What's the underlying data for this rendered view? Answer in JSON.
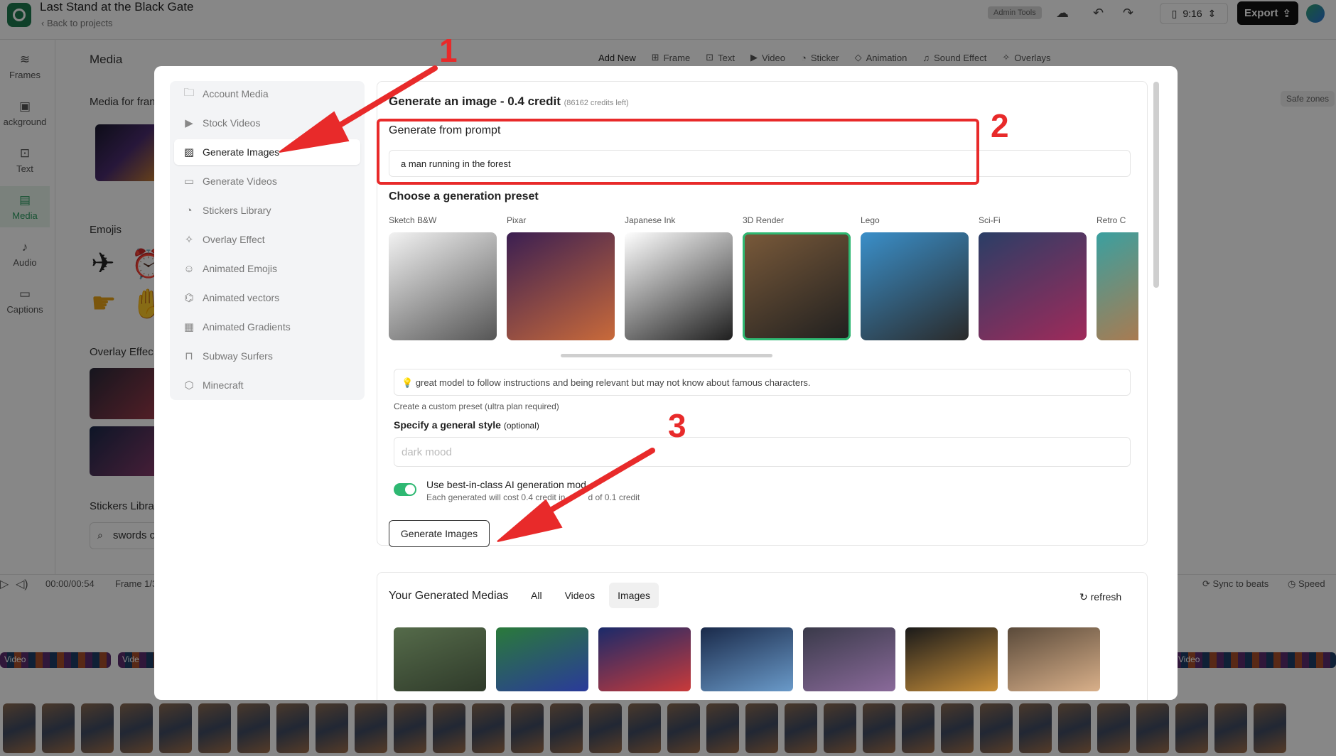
{
  "project": {
    "title": "Last Stand at the Black Gate",
    "back_label": "Back to projects"
  },
  "topbar": {
    "admin_label": "Admin Tools",
    "ratio": "9:16",
    "export_label": "Export"
  },
  "rail": [
    {
      "label": "Frames",
      "icon": "layers-icon"
    },
    {
      "label": "ackground",
      "icon": "background-icon"
    },
    {
      "label": "Text",
      "icon": "text-icon"
    },
    {
      "label": "Media",
      "icon": "media-icon",
      "active": true
    },
    {
      "label": "Audio",
      "icon": "music-icon"
    },
    {
      "label": "Captions",
      "icon": "captions-icon"
    }
  ],
  "media_panel": {
    "heading": "Media",
    "media_for_frame": "Media for fran",
    "emojis": "Emojis",
    "overlay_effects": "Overlay Effec",
    "stickers_library": "Stickers Libra",
    "search_value": "swords c"
  },
  "addbar": {
    "add_new": "Add New",
    "items": [
      "Frame",
      "Text",
      "Video",
      "Sticker",
      "Animation",
      "Sound Effect",
      "Overlays"
    ]
  },
  "safe_zones": "Safe zones",
  "timeline": {
    "time": "00:00/00:54",
    "frame": "Frame 1/3",
    "sync": "Sync to beats",
    "speed": "Speed",
    "strip_label_1": "Video",
    "strip_label_2": "Vide",
    "strip_label_3": "Video"
  },
  "modal": {
    "sidebar": [
      {
        "label": "Account Media",
        "icon": "folder-icon"
      },
      {
        "label": "Stock Videos",
        "icon": "video-icon"
      },
      {
        "label": "Generate Images",
        "icon": "image-icon",
        "active": true
      },
      {
        "label": "Generate Videos",
        "icon": "video-camera-icon"
      },
      {
        "label": "Stickers Library",
        "icon": "sticker-icon"
      },
      {
        "label": "Overlay Effect",
        "icon": "wand-icon"
      },
      {
        "label": "Animated Emojis",
        "icon": "smiley-icon"
      },
      {
        "label": "Animated vectors",
        "icon": "vector-icon"
      },
      {
        "label": "Animated Gradients",
        "icon": "gradient-icon"
      },
      {
        "label": "Subway Surfers",
        "icon": "train-icon"
      },
      {
        "label": "Minecraft",
        "icon": "cube-icon"
      }
    ],
    "generate": {
      "title": "Generate an image - 0.4 credit",
      "credits": "(86162 credits left)",
      "prompt_label": "Generate from prompt",
      "prompt_value": "a man running in the forest",
      "preset_heading": "Choose a generation preset",
      "presets": [
        {
          "label": "Sketch B&W",
          "colors": [
            "#f2f2f2",
            "#555555"
          ]
        },
        {
          "label": "Pixar",
          "colors": [
            "#3b1f52",
            "#c96a3a"
          ]
        },
        {
          "label": "Japanese Ink",
          "colors": [
            "#ffffff",
            "#1e1e1e"
          ]
        },
        {
          "label": "3D Render",
          "colors": [
            "#7a5a3a",
            "#1f1f1f"
          ],
          "selected": true
        },
        {
          "label": "Lego",
          "colors": [
            "#3a8fc9",
            "#2a2a2a"
          ]
        },
        {
          "label": "Sci-Fi",
          "colors": [
            "#2a3e66",
            "#a02a5a"
          ]
        },
        {
          "label": "Retro C",
          "colors": [
            "#3aa0a0",
            "#c9703a"
          ]
        }
      ],
      "tip": "great model to follow instructions and being relevant but may not know about famous characters.",
      "custom_preset": "Create a custom preset (ultra plan required)",
      "style_label": "Specify a general style",
      "style_optional": "(optional)",
      "style_placeholder": "dark mood",
      "toggle_label": "Use best-in-class AI generation mod",
      "toggle_sub": "Each generated will cost 0.4 credit in",
      "toggle_sub_2": "d of 0.1 credit",
      "button": "Generate Images"
    },
    "generated": {
      "title": "Your Generated Medias",
      "filters": [
        "All",
        "Videos",
        "Images"
      ],
      "active_filter": "Images",
      "refresh": "refresh",
      "thumbnails": [
        {
          "colors": [
            "#556b4a",
            "#2f3a2a"
          ]
        },
        {
          "colors": [
            "#2a7a3a",
            "#2a3a9a"
          ]
        },
        {
          "colors": [
            "#1a2a6a",
            "#c93a3a"
          ]
        },
        {
          "colors": [
            "#1a2a4a",
            "#6a9ac9"
          ]
        },
        {
          "colors": [
            "#3a3a4a",
            "#8a6a9a"
          ]
        },
        {
          "colors": [
            "#1a1a1a",
            "#c9903a"
          ]
        },
        {
          "colors": [
            "#5a4a3a",
            "#d9b08a"
          ]
        }
      ]
    }
  },
  "annotations": [
    "1",
    "2",
    "3"
  ],
  "colors": {
    "accent": "#2eb872",
    "annotation": "#e82a2a"
  }
}
